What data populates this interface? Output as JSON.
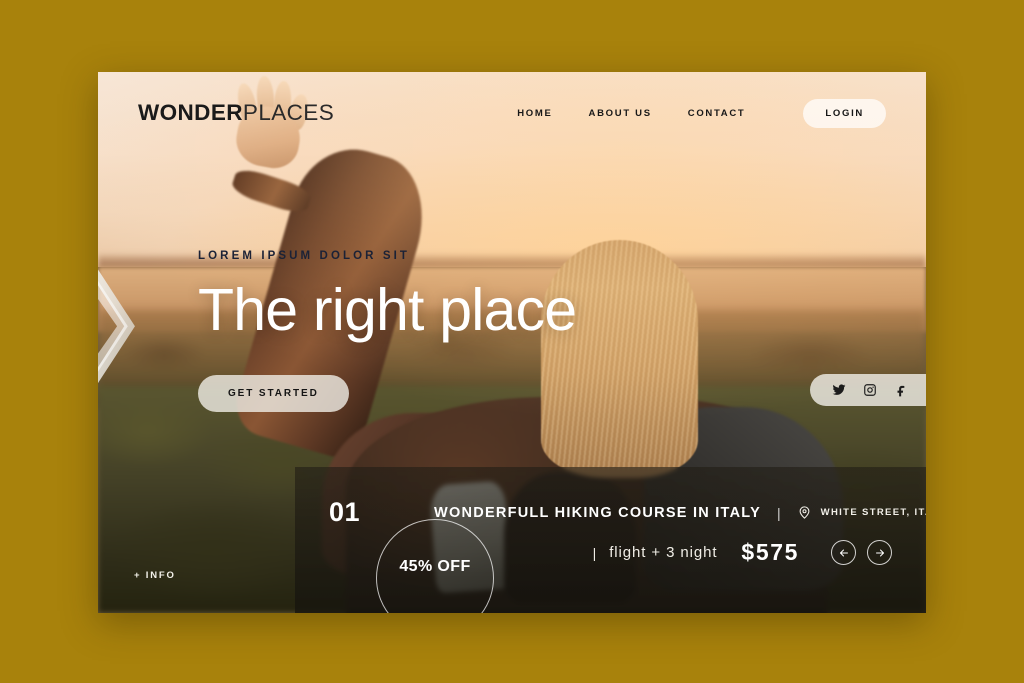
{
  "page": {
    "background_color": "#a8820c",
    "card_background": "#2e2c18"
  },
  "header": {
    "logo": {
      "bold": "WONDER",
      "light": "PLACES"
    },
    "nav": [
      {
        "label": "HOME",
        "name": "nav-home"
      },
      {
        "label": "ABOUT US",
        "name": "nav-about-us"
      },
      {
        "label": "CONTACT",
        "name": "nav-contact"
      }
    ],
    "login_label": "LOGIN"
  },
  "hero": {
    "eyebrow": "LOREM IPSUM DOLOR SIT",
    "headline": "The right place",
    "cta_label": "GET STARTED",
    "eyebrow_color": "#1b2236",
    "headline_color": "#ffffff"
  },
  "social": {
    "items": [
      {
        "name": "twitter-icon",
        "label": "Twitter"
      },
      {
        "name": "instagram-icon",
        "label": "Instagram"
      },
      {
        "name": "facebook-icon",
        "label": "Facebook"
      }
    ]
  },
  "offer": {
    "number": "01",
    "title": "WONDERFULL HIKING COURSE IN ITALY",
    "separator": "|",
    "location": "WHITE STREET, ITALY",
    "discount": "45% OFF",
    "price_separator": "|",
    "price_label": "flight + 3 night",
    "price": "$575",
    "prev_label": "Previous",
    "next_label": "Next"
  },
  "footer": {
    "info_label": "+ INFO"
  }
}
